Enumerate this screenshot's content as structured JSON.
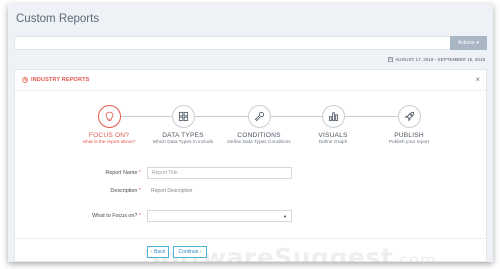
{
  "header": {
    "title": "Custom Reports",
    "actions_label": "Actions",
    "date_range": "AUGUST 17, 2018 - SEPTEMBER 15, 2018"
  },
  "card": {
    "title": "INDUSTRY REPORTS",
    "close_symbol": "×"
  },
  "steps": [
    {
      "title": "FOCUS ON?",
      "subtitle": "what is the report about?",
      "icon": "lightbulb-icon",
      "active": true
    },
    {
      "title": "DATA TYPES",
      "subtitle": "Which Data Types to include",
      "icon": "grid-icon",
      "active": false
    },
    {
      "title": "CONDITIONS",
      "subtitle": "Define Data Types Conditions",
      "icon": "wrench-icon",
      "active": false
    },
    {
      "title": "VISUALS",
      "subtitle": "Define Graph",
      "icon": "bar-chart-icon",
      "active": false
    },
    {
      "title": "PUBLISH",
      "subtitle": "Publish your report",
      "icon": "rocket-icon",
      "active": false
    }
  ],
  "form": {
    "report_name_label": "Report Name",
    "report_name_placeholder": "Report Title",
    "description_label": "Description",
    "description_value": "Report Description",
    "focus_label": "What to Focus on?",
    "focus_value": "",
    "required_mark": "*"
  },
  "buttons": {
    "back": "‹ Back",
    "continue": "Continue ›"
  },
  "watermark": {
    "text": "SoftwareSuggest",
    "suffix": ".com"
  },
  "colors": {
    "accent": "#e2574c",
    "button_blue": "#2f8fc0",
    "actions_bg": "#a9b6c4"
  }
}
